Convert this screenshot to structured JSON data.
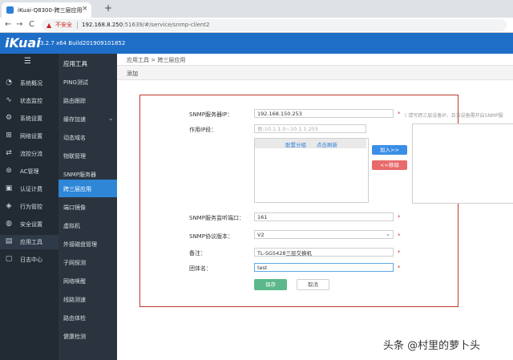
{
  "browser": {
    "tab_title": "iKuai-Q8300-跨三层应用",
    "tab_close": "×",
    "new_tab": "+",
    "back": "←",
    "forward": "→",
    "reload": "C",
    "insecure_label": "不安全",
    "url_host": "192.168.8.250",
    "url_rest": ":51639/#/service/snmp-client2"
  },
  "header": {
    "logo": "iKuai",
    "version": "3.2.7 x64 Build201909101852"
  },
  "sidebar": {
    "items": [
      {
        "label": "系统概况",
        "icon": "◔"
      },
      {
        "label": "状态监控",
        "icon": "∿"
      },
      {
        "label": "系统设置",
        "icon": "⚙"
      },
      {
        "label": "网络设置",
        "icon": "⊞"
      },
      {
        "label": "流控分流",
        "icon": "⇄"
      },
      {
        "label": "AC管理",
        "icon": "⊚"
      },
      {
        "label": "认证计费",
        "icon": "▣"
      },
      {
        "label": "行为管控",
        "icon": "◈"
      },
      {
        "label": "安全设置",
        "icon": "◍"
      },
      {
        "label": "应用工具",
        "icon": "▤"
      },
      {
        "label": "日志中心",
        "icon": "▢"
      }
    ]
  },
  "subnav": {
    "heading": "应用工具",
    "items": [
      "PING测试",
      "路由跟踪",
      "缓存加速",
      "动态域名",
      "物联管理",
      "SNMP服务器",
      "跨三层应用",
      "端口镜像",
      "虚拟机",
      "外接磁盘管理",
      "子网探测",
      "网络唤醒",
      "线路测速",
      "路由体检",
      "健康检测"
    ]
  },
  "main": {
    "breadcrumb": "应用工具 > 跨三层应用",
    "action": "添加"
  },
  "form": {
    "snmp_server_ip_label": "SNMP服务器IP：",
    "snmp_server_ip_value": "192.168.150.253",
    "snmp_server_ip_hint": "( 请写跨三层设备IP，且该设备需开启SNMP服",
    "scope_label": "作用IP段：",
    "scope_placeholder": "例:10.1.1.0~10.1.1.255",
    "list_link_config": "配置分组",
    "list_link_refresh": "点击刷新",
    "add_button": "加入>>",
    "remove_button": "<<移除",
    "port_label": "SNMP服务监听端口：",
    "port_value": "161",
    "version_label": "SNMP协议版本：",
    "version_value": "V2",
    "remark_label": "备注：",
    "remark_value": "TL-SG5428三层交换机",
    "community_label": "团体名：",
    "community_value": "test",
    "save_button": "保存",
    "cancel_button": "取消",
    "required_mark": "*"
  },
  "watermark": "头条 @村里的萝卜头",
  "colors": {
    "header_blue": "#1e6ec8",
    "sidebar_dark": "#222a33",
    "active_blue": "#2f86d6",
    "save_green": "#5cb88a",
    "remove_red": "#e86a6a",
    "form_border_red": "#c0392b"
  }
}
